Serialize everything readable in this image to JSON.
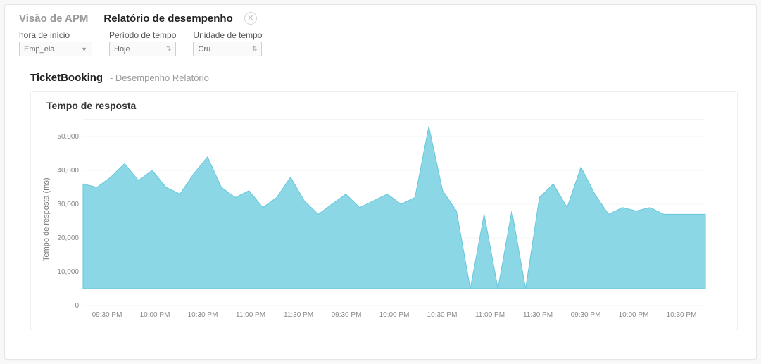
{
  "tabs": {
    "inactive": "Visão de APM",
    "active": "Relatório de desempenho"
  },
  "filters": {
    "start_time": {
      "label": "hora de início",
      "value": "Emp_ela"
    },
    "period": {
      "label": "Período de tempo",
      "value": "Hoje"
    },
    "unit": {
      "label": "Unidade de tempo",
      "value": "Cru"
    }
  },
  "report": {
    "app_name": "TicketBooking",
    "subtitle": "- Desempenho Relatório"
  },
  "chart_data": {
    "type": "area",
    "title": "Tempo de resposta",
    "ylabel": "Tempo de resposta (ms)",
    "xlabel": "",
    "ylim": [
      0,
      55000
    ],
    "yticks": [
      0,
      10000,
      20000,
      30000,
      40000,
      50000
    ],
    "ytick_labels": [
      "0",
      "10,000",
      "20,000",
      "30,000",
      "40,000",
      "50,000"
    ],
    "x_labels": [
      "09:30 PM",
      "10:00 PM",
      "10:30 PM",
      "11:00 PM",
      "11:30 PM",
      "09:30 PM",
      "10:00 PM",
      "10:30 PM",
      "11:00 PM",
      "11:30 PM",
      "09:30 PM",
      "10:00 PM",
      "10:30 PM"
    ],
    "baseline": 5000,
    "values": [
      36000,
      35000,
      38000,
      42000,
      37000,
      40000,
      35000,
      33000,
      39000,
      44000,
      35000,
      32000,
      34000,
      29000,
      32000,
      38000,
      31000,
      27000,
      30000,
      33000,
      29000,
      31000,
      33000,
      30000,
      32000,
      53000,
      34000,
      28000,
      5000,
      27000,
      5000,
      28000,
      5000,
      32000,
      36000,
      29000,
      41000,
      33000,
      27000,
      29000,
      28000,
      29000,
      27000,
      27000,
      27000,
      27000
    ]
  }
}
